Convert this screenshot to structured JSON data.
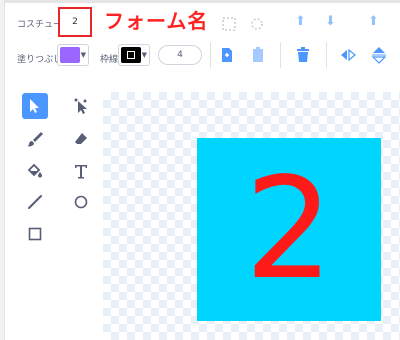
{
  "header": {
    "costume_label": "コスチューム",
    "costume_name": "2",
    "annotation": "フォーム名"
  },
  "toolbar": {
    "fill_label": "塗りつぶし",
    "fill_color": "#9966ff",
    "outline_label": "枠線",
    "outline_color": "#000000",
    "outline_width": "4"
  },
  "tools": [
    "select",
    "reshape",
    "brush",
    "eraser",
    "fill",
    "text",
    "line",
    "circle",
    "rectangle"
  ],
  "costume": {
    "background_color": "#00d5ff",
    "text": "2",
    "text_color": "#ff1a1a"
  }
}
